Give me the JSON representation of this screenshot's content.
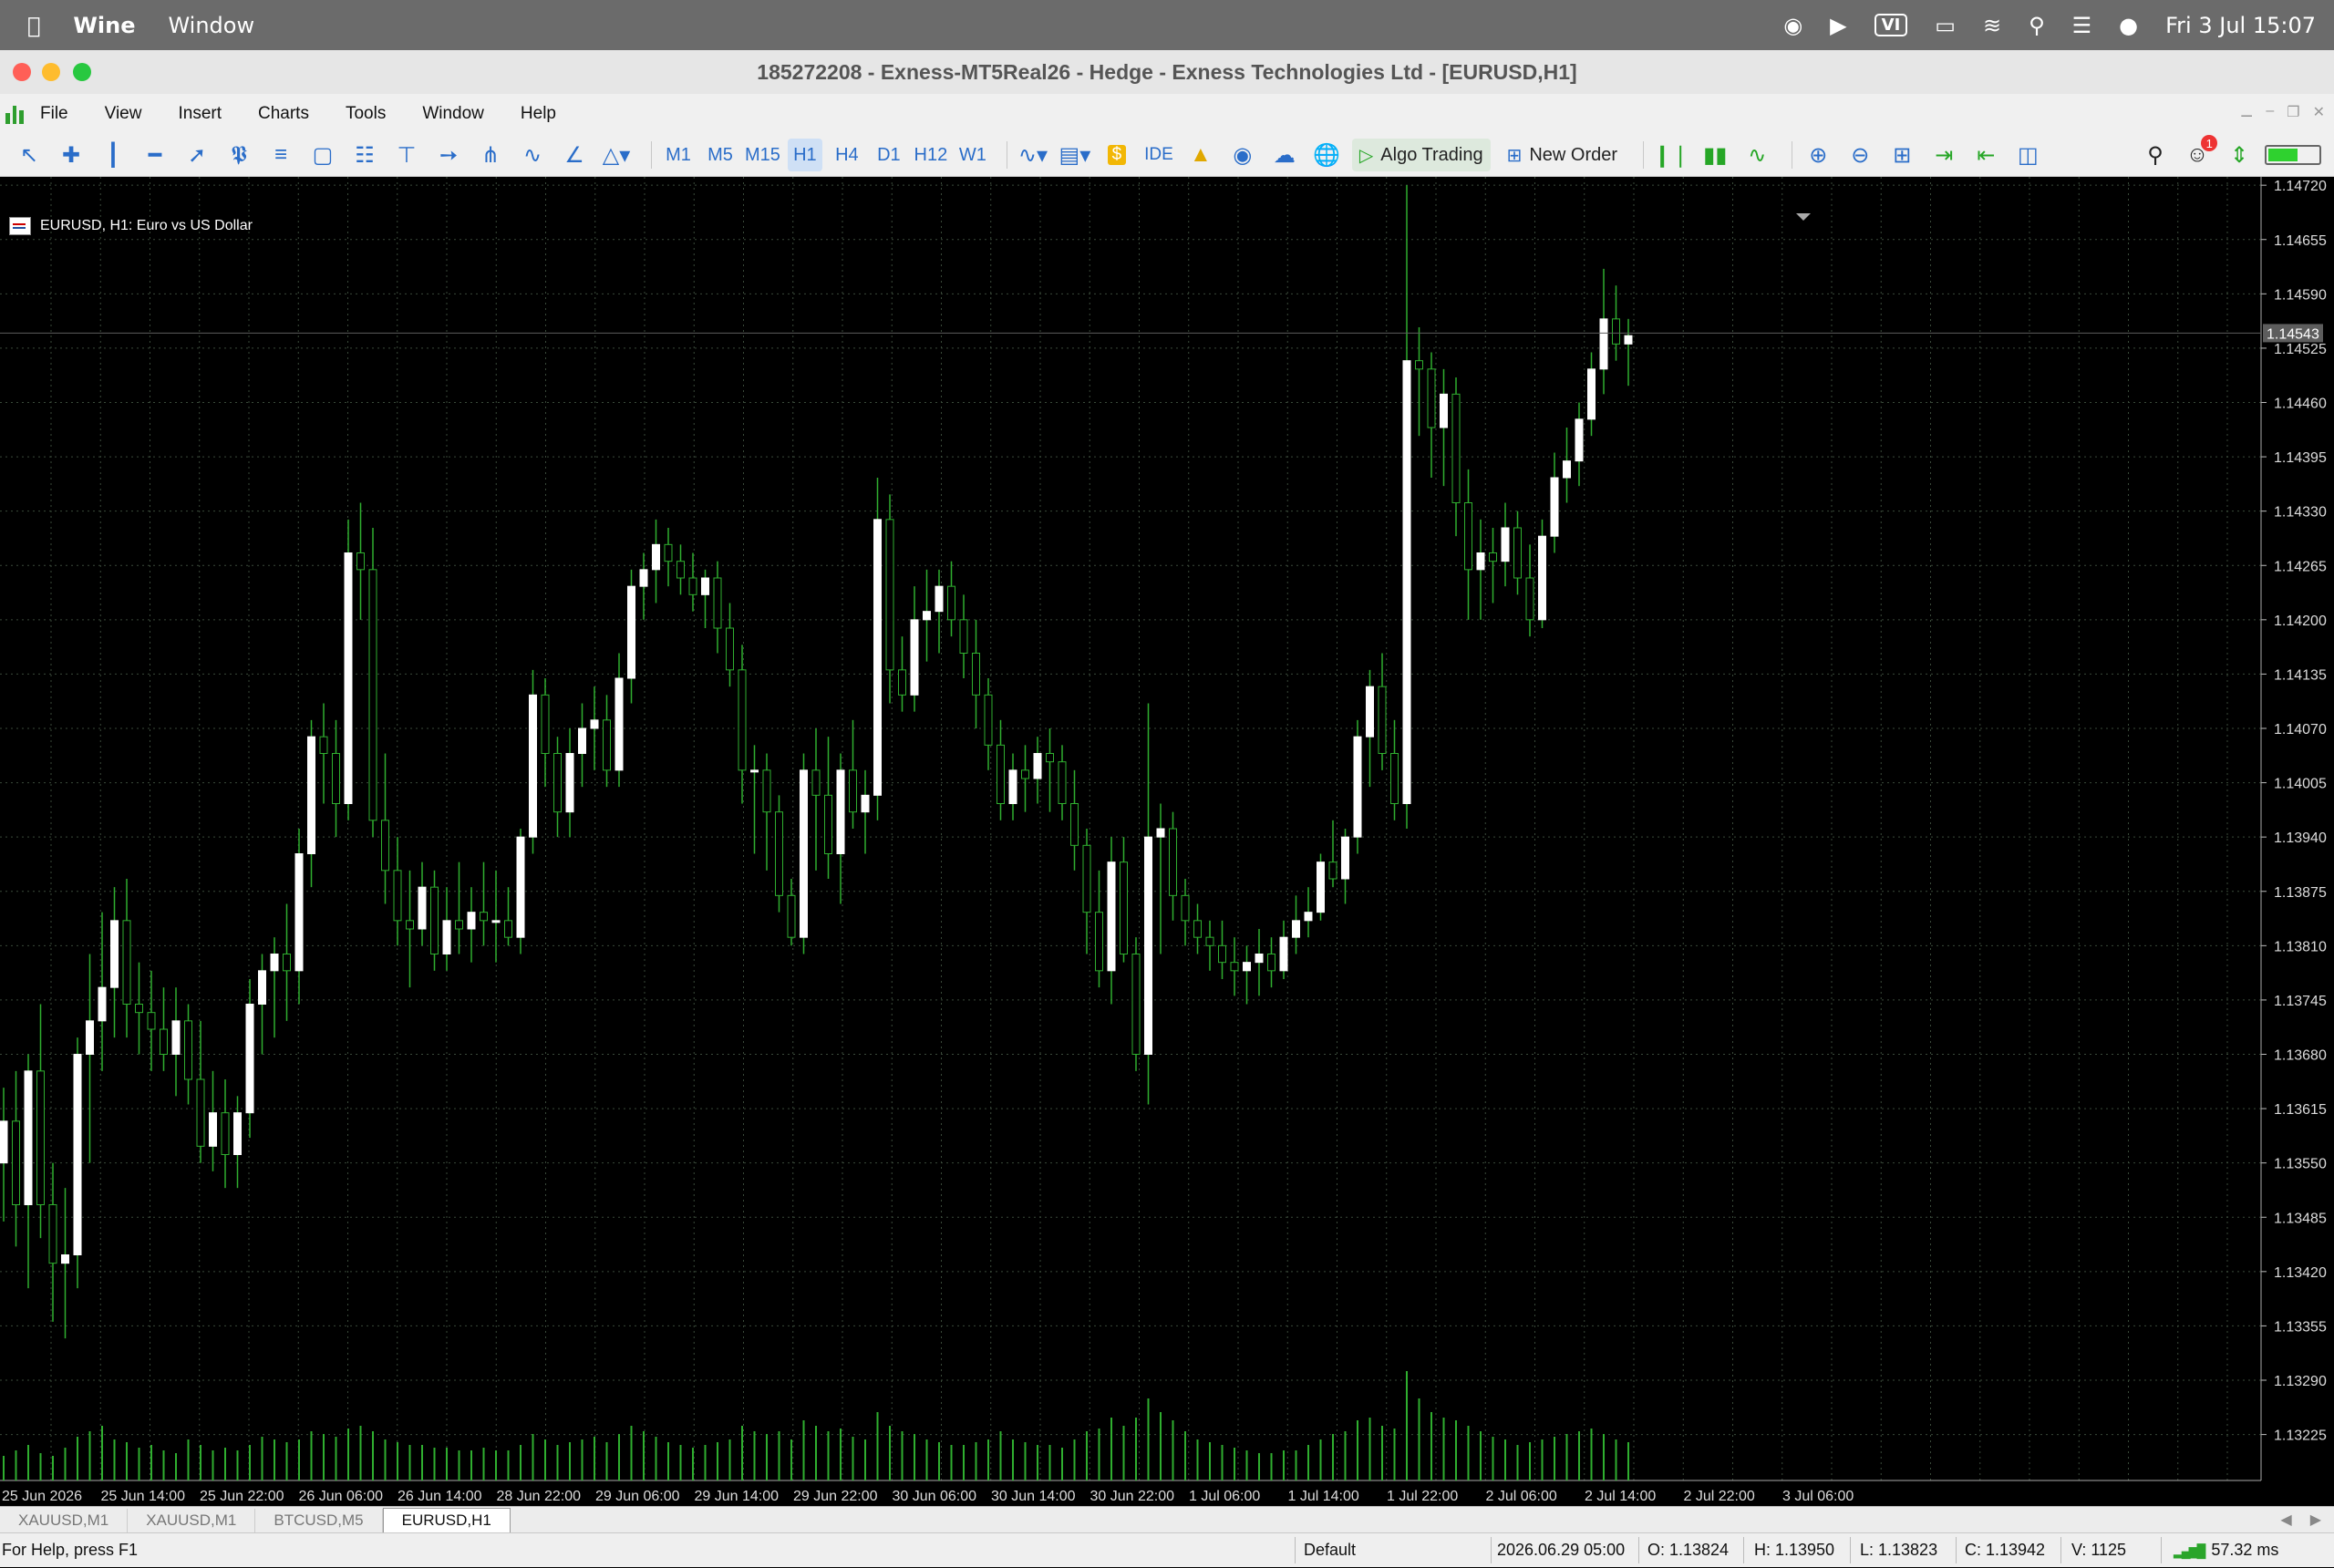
{
  "mac_menubar": {
    "app": "Wine",
    "menu": "Window",
    "clock": "Fri 3 Jul  15:07",
    "input_method": "VI"
  },
  "window": {
    "title": "185272208 - Exness-MT5Real26 - Hedge - Exness Technologies Ltd - [EURUSD,H1]"
  },
  "menu": [
    "File",
    "View",
    "Insert",
    "Charts",
    "Tools",
    "Window",
    "Help"
  ],
  "toolbar": {
    "timeframes": [
      "M1",
      "M5",
      "M15",
      "H1",
      "H4",
      "D1",
      "H12",
      "W1"
    ],
    "active_timeframe": "H1",
    "ide": "IDE",
    "algo_trading": "Algo Trading",
    "new_order": "New Order",
    "notifications": "1"
  },
  "chart": {
    "label": "EURUSD, H1:  Euro vs US Dollar",
    "colors": {
      "background": "#000000",
      "grid": "#3a4a3a",
      "candle_bull": "#ffffff",
      "candle_bear": "#000000",
      "wick": "#2fae2f",
      "volume": "#2fae2f",
      "bid_line": "#5d5d5d"
    }
  },
  "chart_data": {
    "type": "candlestick",
    "symbol": "EURUSD",
    "timeframe": "H1",
    "y_ticks": [
      "1.14720",
      "1.14655",
      "1.14590",
      "1.14525",
      "1.14460",
      "1.14395",
      "1.14330",
      "1.14265",
      "1.14200",
      "1.14135",
      "1.14070",
      "1.14005",
      "1.13940",
      "1.13875",
      "1.13810",
      "1.13745",
      "1.13680",
      "1.13615",
      "1.13550",
      "1.13485",
      "1.13420",
      "1.13355",
      "1.13290",
      "1.13225"
    ],
    "ylim": [
      1.1317,
      1.1473
    ],
    "current_price": "1.14543",
    "x_labels": [
      "25 Jun 2026",
      "25 Jun 14:00",
      "25 Jun 22:00",
      "26 Jun 06:00",
      "26 Jun 14:00",
      "28 Jun 22:00",
      "29 Jun 06:00",
      "29 Jun 14:00",
      "29 Jun 22:00",
      "30 Jun 06:00",
      "30 Jun 14:00",
      "30 Jun 22:00",
      "1 Jul 06:00",
      "1 Jul 14:00",
      "1 Jul 22:00",
      "2 Jul 06:00",
      "2 Jul 14:00",
      "2 Jul 22:00",
      "3 Jul 06:00"
    ],
    "candles_ohlc": [
      [
        1.1355,
        1.1364,
        1.1348,
        1.136
      ],
      [
        1.136,
        1.1366,
        1.1345,
        1.135
      ],
      [
        1.135,
        1.1368,
        1.134,
        1.1366
      ],
      [
        1.1366,
        1.1374,
        1.1346,
        1.135
      ],
      [
        1.135,
        1.1355,
        1.1336,
        1.1343
      ],
      [
        1.1343,
        1.1352,
        1.1334,
        1.1344
      ],
      [
        1.1344,
        1.137,
        1.134,
        1.1368
      ],
      [
        1.1368,
        1.138,
        1.1355,
        1.1372
      ],
      [
        1.1372,
        1.1385,
        1.1366,
        1.1376
      ],
      [
        1.1376,
        1.1388,
        1.137,
        1.1384
      ],
      [
        1.1384,
        1.1389,
        1.137,
        1.1374
      ],
      [
        1.1374,
        1.1379,
        1.1368,
        1.1373
      ],
      [
        1.1373,
        1.1378,
        1.1366,
        1.1371
      ],
      [
        1.1371,
        1.1376,
        1.1366,
        1.1368
      ],
      [
        1.1368,
        1.1376,
        1.1363,
        1.1372
      ],
      [
        1.1372,
        1.1374,
        1.1362,
        1.1365
      ],
      [
        1.1365,
        1.1372,
        1.1355,
        1.1357
      ],
      [
        1.1357,
        1.1366,
        1.1354,
        1.1361
      ],
      [
        1.1361,
        1.1365,
        1.1352,
        1.1356
      ],
      [
        1.1356,
        1.1363,
        1.1352,
        1.1361
      ],
      [
        1.1361,
        1.1377,
        1.1358,
        1.1374
      ],
      [
        1.1374,
        1.138,
        1.1368,
        1.1378
      ],
      [
        1.1378,
        1.1382,
        1.137,
        1.138
      ],
      [
        1.138,
        1.1386,
        1.1372,
        1.1378
      ],
      [
        1.1378,
        1.1395,
        1.1374,
        1.1392
      ],
      [
        1.1392,
        1.1408,
        1.1388,
        1.1406
      ],
      [
        1.1406,
        1.141,
        1.1398,
        1.1404
      ],
      [
        1.1404,
        1.1408,
        1.1394,
        1.1398
      ],
      [
        1.1398,
        1.1432,
        1.1396,
        1.1428
      ],
      [
        1.1428,
        1.1434,
        1.142,
        1.1426
      ],
      [
        1.1426,
        1.1431,
        1.1394,
        1.1396
      ],
      [
        1.1396,
        1.1404,
        1.1386,
        1.139
      ],
      [
        1.139,
        1.1394,
        1.1381,
        1.1384
      ],
      [
        1.1384,
        1.139,
        1.1376,
        1.1383
      ],
      [
        1.1383,
        1.1391,
        1.1381,
        1.1388
      ],
      [
        1.1388,
        1.139,
        1.1378,
        1.138
      ],
      [
        1.138,
        1.1388,
        1.1378,
        1.1384
      ],
      [
        1.1384,
        1.1391,
        1.138,
        1.1383
      ],
      [
        1.1383,
        1.1388,
        1.1379,
        1.1385
      ],
      [
        1.1385,
        1.1391,
        1.1381,
        1.1384
      ],
      [
        1.1384,
        1.139,
        1.1379,
        1.1384
      ],
      [
        1.1384,
        1.1388,
        1.1381,
        1.1382
      ],
      [
        1.1382,
        1.1395,
        1.138,
        1.1394
      ],
      [
        1.1394,
        1.1414,
        1.1392,
        1.1411
      ],
      [
        1.1411,
        1.1413,
        1.14,
        1.1404
      ],
      [
        1.1404,
        1.1406,
        1.1394,
        1.1397
      ],
      [
        1.1397,
        1.1407,
        1.1394,
        1.1404
      ],
      [
        1.1404,
        1.141,
        1.14,
        1.1407
      ],
      [
        1.1407,
        1.1412,
        1.1402,
        1.1408
      ],
      [
        1.1408,
        1.1411,
        1.14,
        1.1402
      ],
      [
        1.1402,
        1.1416,
        1.14,
        1.1413
      ],
      [
        1.1413,
        1.1426,
        1.141,
        1.1424
      ],
      [
        1.1424,
        1.1428,
        1.142,
        1.1426
      ],
      [
        1.1426,
        1.1432,
        1.1422,
        1.1429
      ],
      [
        1.1429,
        1.1431,
        1.1424,
        1.1427
      ],
      [
        1.1427,
        1.1429,
        1.1423,
        1.1425
      ],
      [
        1.1425,
        1.1428,
        1.1421,
        1.1423
      ],
      [
        1.1423,
        1.1426,
        1.1419,
        1.1425
      ],
      [
        1.1425,
        1.1427,
        1.1416,
        1.1419
      ],
      [
        1.1419,
        1.1422,
        1.1412,
        1.1414
      ],
      [
        1.1414,
        1.1417,
        1.1398,
        1.1402
      ],
      [
        1.1402,
        1.1405,
        1.1392,
        1.1402
      ],
      [
        1.1402,
        1.1404,
        1.139,
        1.1397
      ],
      [
        1.1397,
        1.1399,
        1.1385,
        1.1387
      ],
      [
        1.1387,
        1.1389,
        1.1381,
        1.1382
      ],
      [
        1.1382,
        1.1404,
        1.138,
        1.1402
      ],
      [
        1.1402,
        1.1407,
        1.139,
        1.1399
      ],
      [
        1.1399,
        1.1406,
        1.1389,
        1.1392
      ],
      [
        1.1392,
        1.1404,
        1.1386,
        1.1402
      ],
      [
        1.1402,
        1.1408,
        1.1395,
        1.1397
      ],
      [
        1.1397,
        1.1402,
        1.1392,
        1.1399
      ],
      [
        1.1399,
        1.1437,
        1.1396,
        1.1432
      ],
      [
        1.1432,
        1.1435,
        1.141,
        1.1414
      ],
      [
        1.1414,
        1.1418,
        1.1409,
        1.1411
      ],
      [
        1.1411,
        1.1424,
        1.1409,
        1.142
      ],
      [
        1.142,
        1.1426,
        1.1415,
        1.1421
      ],
      [
        1.1421,
        1.1426,
        1.1416,
        1.1424
      ],
      [
        1.1424,
        1.1427,
        1.1418,
        1.142
      ],
      [
        1.142,
        1.1423,
        1.1413,
        1.1416
      ],
      [
        1.1416,
        1.142,
        1.1407,
        1.1411
      ],
      [
        1.1411,
        1.1413,
        1.1402,
        1.1405
      ],
      [
        1.1405,
        1.1408,
        1.1396,
        1.1398
      ],
      [
        1.1398,
        1.1404,
        1.1396,
        1.1402
      ],
      [
        1.1402,
        1.1405,
        1.1397,
        1.1401
      ],
      [
        1.1401,
        1.1406,
        1.1398,
        1.1404
      ],
      [
        1.1404,
        1.1407,
        1.1397,
        1.1403
      ],
      [
        1.1403,
        1.1405,
        1.1396,
        1.1398
      ],
      [
        1.1398,
        1.1402,
        1.139,
        1.1393
      ],
      [
        1.1393,
        1.1395,
        1.138,
        1.1385
      ],
      [
        1.1385,
        1.139,
        1.1376,
        1.1378
      ],
      [
        1.1378,
        1.1394,
        1.1374,
        1.1391
      ],
      [
        1.1391,
        1.1394,
        1.1379,
        1.138
      ],
      [
        1.138,
        1.1382,
        1.1366,
        1.1368
      ],
      [
        1.1368,
        1.141,
        1.1362,
        1.1394
      ],
      [
        1.1394,
        1.1398,
        1.138,
        1.1395
      ],
      [
        1.1395,
        1.1397,
        1.1384,
        1.1387
      ],
      [
        1.1387,
        1.1389,
        1.1381,
        1.1384
      ],
      [
        1.1384,
        1.1386,
        1.138,
        1.1382
      ],
      [
        1.1382,
        1.1384,
        1.1378,
        1.1381
      ],
      [
        1.1381,
        1.1384,
        1.1377,
        1.1379
      ],
      [
        1.1379,
        1.1382,
        1.1375,
        1.1378
      ],
      [
        1.1378,
        1.1381,
        1.1374,
        1.1379
      ],
      [
        1.1379,
        1.1383,
        1.1375,
        1.138
      ],
      [
        1.138,
        1.1382,
        1.1376,
        1.1378
      ],
      [
        1.1378,
        1.1384,
        1.1377,
        1.1382
      ],
      [
        1.1382,
        1.1387,
        1.138,
        1.1384
      ],
      [
        1.1384,
        1.1388,
        1.1382,
        1.1385
      ],
      [
        1.1385,
        1.1392,
        1.1384,
        1.1391
      ],
      [
        1.1391,
        1.1396,
        1.1388,
        1.1389
      ],
      [
        1.1389,
        1.1395,
        1.1386,
        1.1394
      ],
      [
        1.1394,
        1.1408,
        1.1392,
        1.1406
      ],
      [
        1.1406,
        1.1414,
        1.14,
        1.1412
      ],
      [
        1.1412,
        1.1416,
        1.1402,
        1.1404
      ],
      [
        1.1404,
        1.1408,
        1.1396,
        1.1398
      ],
      [
        1.1398,
        1.1472,
        1.1395,
        1.1451
      ],
      [
        1.1451,
        1.1455,
        1.1442,
        1.145
      ],
      [
        1.145,
        1.1452,
        1.1437,
        1.1443
      ],
      [
        1.1443,
        1.145,
        1.1436,
        1.1447
      ],
      [
        1.1447,
        1.1449,
        1.143,
        1.1434
      ],
      [
        1.1434,
        1.1438,
        1.142,
        1.1426
      ],
      [
        1.1426,
        1.1432,
        1.142,
        1.1428
      ],
      [
        1.1428,
        1.1431,
        1.1422,
        1.1427
      ],
      [
        1.1427,
        1.1434,
        1.1424,
        1.1431
      ],
      [
        1.1431,
        1.1433,
        1.1423,
        1.1425
      ],
      [
        1.1425,
        1.1429,
        1.1418,
        1.142
      ],
      [
        1.142,
        1.1432,
        1.1419,
        1.143
      ],
      [
        1.143,
        1.144,
        1.1428,
        1.1437
      ],
      [
        1.1437,
        1.1443,
        1.1434,
        1.1439
      ],
      [
        1.1439,
        1.1446,
        1.1436,
        1.1444
      ],
      [
        1.1444,
        1.1452,
        1.1442,
        1.145
      ],
      [
        1.145,
        1.1462,
        1.1447,
        1.1456
      ],
      [
        1.1456,
        1.146,
        1.1451,
        1.1453
      ],
      [
        1.1453,
        1.1456,
        1.1448,
        1.1454
      ]
    ],
    "volumes": [
      18,
      22,
      26,
      20,
      18,
      24,
      32,
      36,
      40,
      30,
      28,
      24,
      26,
      22,
      20,
      30,
      26,
      22,
      24,
      22,
      26,
      32,
      30,
      28,
      30,
      36,
      34,
      32,
      38,
      40,
      36,
      30,
      28,
      26,
      26,
      24,
      24,
      22,
      22,
      24,
      22,
      22,
      26,
      34,
      30,
      26,
      28,
      30,
      32,
      28,
      34,
      40,
      36,
      32,
      28,
      26,
      24,
      26,
      28,
      30,
      40,
      36,
      34,
      36,
      30,
      44,
      40,
      36,
      38,
      32,
      30,
      50,
      40,
      36,
      34,
      30,
      28,
      26,
      26,
      28,
      30,
      36,
      30,
      28,
      26,
      26,
      24,
      30,
      36,
      38,
      46,
      40,
      46,
      60,
      50,
      44,
      36,
      30,
      28,
      26,
      24,
      22,
      20,
      20,
      22,
      22,
      26,
      30,
      34,
      36,
      44,
      46,
      40,
      38,
      80,
      60,
      50,
      46,
      44,
      40,
      36,
      32,
      30,
      26,
      28,
      30,
      32,
      34,
      36,
      38,
      34,
      30,
      28
    ]
  },
  "tabs": [
    "XAUUSD,M1",
    "XAUUSD,M1",
    "BTCUSD,M5",
    "EURUSD,H1"
  ],
  "active_tab": "EURUSD,H1",
  "status": {
    "help": "For Help, press F1",
    "profile": "Default",
    "datetime": "2026.06.29 05:00",
    "open": "O: 1.13824",
    "high": "H: 1.13950",
    "low": "L: 1.13823",
    "close": "C: 1.13942",
    "volume": "V: 1125",
    "ping": "57.32 ms"
  }
}
